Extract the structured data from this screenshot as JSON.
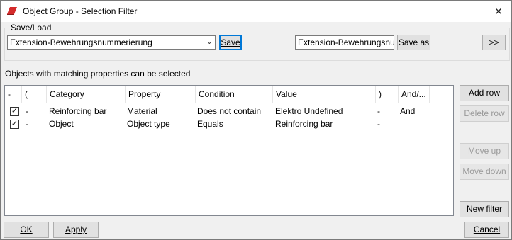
{
  "window": {
    "title": "Object Group - Selection Filter",
    "close_glyph": "✕"
  },
  "saveload": {
    "group_label": "Save/Load",
    "combo_value": "Extension-Bewehrungsnummerierung",
    "save_label": "Save",
    "saveas_value": "Extension-Bewehrungsnu",
    "saveas_label": "Save as",
    "expand_label": ">>"
  },
  "note": "Objects with matching properties can be selected",
  "table": {
    "columns": [
      "-",
      "(",
      "Category",
      "Property",
      "Condition",
      "Value",
      ")",
      "And/..."
    ],
    "rows": [
      {
        "checked": true,
        "open": "-",
        "category": "Reinforcing bar",
        "property": "Material",
        "condition": "Does not contain",
        "value": "Elektro Undefined",
        "close": "-",
        "andor": "And"
      },
      {
        "checked": true,
        "open": "-",
        "category": "Object",
        "property": "Object type",
        "condition": "Equals",
        "value": "Reinforcing bar",
        "close": "-",
        "andor": ""
      }
    ]
  },
  "side_buttons": {
    "add_row": "Add row",
    "delete_row": "Delete row",
    "move_up": "Move up",
    "move_down": "Move down",
    "new_filter": "New filter"
  },
  "bottom_buttons": {
    "ok": "OK",
    "apply": "Apply",
    "cancel": "Cancel"
  },
  "colors": {
    "icon_red": "#d42b2b",
    "focus_blue": "#0078d7"
  }
}
